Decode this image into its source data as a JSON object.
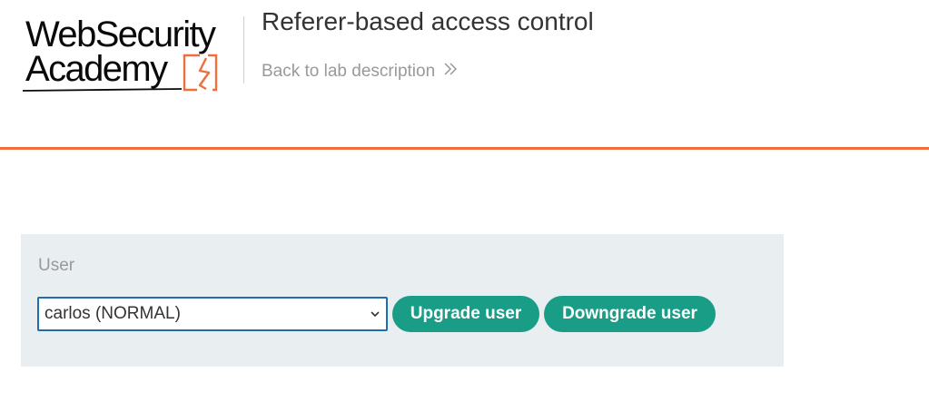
{
  "header": {
    "logo": {
      "line1": "WebSecurity",
      "line2": "Academy",
      "brand_color": "#ee6f3b"
    },
    "lab_title": "Referer-based access control",
    "back_link_label": "Back to lab description",
    "back_link_icon": "double-chevron-right-icon"
  },
  "colors": {
    "accent": "#ee6f3b",
    "button": "#1a9d87",
    "panel_background": "#e9eef1",
    "select_border": "#1f6cb0"
  },
  "form": {
    "label": "User",
    "selected_user": "carlos (NORMAL)",
    "upgrade_label": "Upgrade user",
    "downgrade_label": "Downgrade user"
  }
}
